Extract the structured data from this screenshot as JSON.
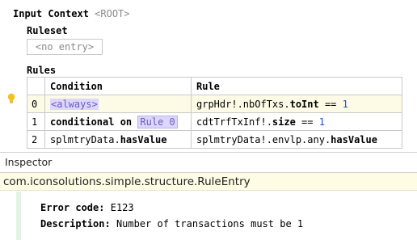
{
  "editor": {
    "input_context_label": "Input Context",
    "input_context_value": "<ROOT>",
    "ruleset_label": "Ruleset",
    "ruleset_value": "<no entry>",
    "rules_label": "Rules"
  },
  "rules_table": {
    "headers": [
      "Condition",
      "Rule"
    ],
    "rows": [
      {
        "index": "0",
        "condition": "<always>",
        "rule_prefix": "grpHdr!.nbOfTxs.",
        "rule_method": "toInt",
        "rule_op": " == ",
        "rule_value": "1"
      },
      {
        "index": "1",
        "condition_kw": "conditional on",
        "condition_ref": "Rule 0",
        "rule_prefix": "cdtTrfTxInf!.",
        "rule_method": "size",
        "rule_op": " == ",
        "rule_value": "1"
      },
      {
        "index": "2",
        "condition_prefix": "splmtryData.",
        "condition_method": "hasValue",
        "rule_prefix": "splmtryData!.envlp.any.",
        "rule_method": "hasValue"
      }
    ]
  },
  "inspector": {
    "title": "Inspector",
    "entry_class": "com.iconsolutions.simple.structure.RuleEntry",
    "error_code_label": "Error code:",
    "error_code": "E123",
    "description_label": "Description:",
    "description": "Number of transactions must be 1"
  },
  "colors": {
    "highlight_row": "#fdfbe5",
    "reference_bg": "#ddd6ff",
    "number": "#1750eb",
    "placeholder": "#8a8a8a"
  },
  "icons": {
    "intention": "lightbulb-icon"
  }
}
